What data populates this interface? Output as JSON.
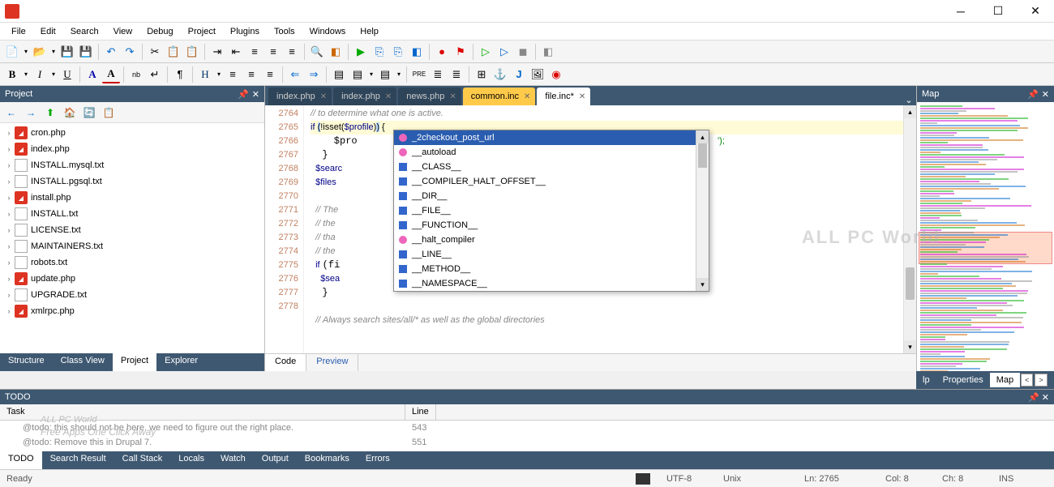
{
  "menus": [
    "File",
    "Edit",
    "Search",
    "View",
    "Debug",
    "Project",
    "Plugins",
    "Tools",
    "Windows",
    "Help"
  ],
  "project": {
    "title": "Project",
    "items": [
      {
        "name": "cron.php",
        "type": "php"
      },
      {
        "name": "index.php",
        "type": "php"
      },
      {
        "name": "INSTALL.mysql.txt",
        "type": "txt"
      },
      {
        "name": "INSTALL.pgsql.txt",
        "type": "txt"
      },
      {
        "name": "install.php",
        "type": "php"
      },
      {
        "name": "INSTALL.txt",
        "type": "txt"
      },
      {
        "name": "LICENSE.txt",
        "type": "txt"
      },
      {
        "name": "MAINTAINERS.txt",
        "type": "txt"
      },
      {
        "name": "robots.txt",
        "type": "txt"
      },
      {
        "name": "update.php",
        "type": "php"
      },
      {
        "name": "UPGRADE.txt",
        "type": "txt"
      },
      {
        "name": "xmlrpc.php",
        "type": "php"
      }
    ],
    "tabs": [
      "Structure",
      "Class View",
      "Project",
      "Explorer"
    ],
    "activeTab": "Project"
  },
  "editor": {
    "tabs": [
      {
        "label": "index.php",
        "kind": "norm"
      },
      {
        "label": "index.php",
        "kind": "norm"
      },
      {
        "label": "news.php",
        "kind": "norm"
      },
      {
        "label": "common.inc",
        "kind": "yellow"
      },
      {
        "label": "file.inc*",
        "kind": "active"
      }
    ],
    "lines": [
      "2764",
      "2765",
      "2766",
      "2767",
      "2768",
      "2769",
      "2770",
      "2771",
      "2772",
      "2773",
      "2774",
      "2775",
      "2776",
      "2777",
      "2778"
    ],
    "code": {
      "l0": "// to determine what one is active.",
      "l1a": "if ",
      "l1b": "(",
      "l1c": "!isset(",
      "l1d": "$profile",
      "l1e": ")",
      "l1f": ")",
      "l1g": " {",
      "l2": "    $pro",
      "l2tail": "');",
      "l3": "  }",
      "l4": "  $searc",
      "l5": "  $files",
      "l6": "",
      "l7": "  // The                                      tions of modules and",
      "l8": "  // the                                      tine in the same way",
      "l9": "  // tha                                      void changing anything",
      "l10": "  // the                                      ectories.",
      "l11a": "  if ",
      "l11b": "(fi",
      "l12": "    $sea",
      "l13": "  }",
      "l14": "",
      "l15": "  // Always search sites/all/* as well as the global directories"
    },
    "bottomTabs": [
      "Code",
      "Preview"
    ],
    "activeBottom": "Code"
  },
  "autocomplete": [
    {
      "label": "_2checkout_post_url",
      "icon": "pink",
      "sel": true
    },
    {
      "label": "__autoload",
      "icon": "pink"
    },
    {
      "label": "__CLASS__",
      "icon": "blue"
    },
    {
      "label": "__COMPILER_HALT_OFFSET__",
      "icon": "blue"
    },
    {
      "label": "__DIR__",
      "icon": "blue"
    },
    {
      "label": "__FILE__",
      "icon": "blue"
    },
    {
      "label": "__FUNCTION__",
      "icon": "blue"
    },
    {
      "label": "__halt_compiler",
      "icon": "pink"
    },
    {
      "label": "__LINE__",
      "icon": "blue"
    },
    {
      "label": "__METHOD__",
      "icon": "blue"
    },
    {
      "label": "__NAMESPACE__",
      "icon": "blue"
    }
  ],
  "map": {
    "title": "Map"
  },
  "rightTabs": [
    "lp",
    "Properties",
    "Map"
  ],
  "todo": {
    "title": "TODO",
    "cols": {
      "task": "Task",
      "line": "Line"
    },
    "rows": [
      {
        "task": "@todo: this should not be here. we need to figure out the right place.",
        "line": "543"
      },
      {
        "task": "@todo: Remove this in Drupal 7.",
        "line": "551"
      }
    ]
  },
  "bottomTabs": [
    "TODO",
    "Search Result",
    "Call Stack",
    "Locals",
    "Watch",
    "Output",
    "Bookmarks",
    "Errors"
  ],
  "status": {
    "ready": "Ready",
    "encoding": "UTF-8",
    "eol": "Unix",
    "ln": "Ln: 2765",
    "col": "Col: 8",
    "ch": "Ch: 8",
    "ins": "INS"
  },
  "watermark": {
    "l1": "ALL PC World",
    "l2": "Free Apps One Click Away"
  }
}
